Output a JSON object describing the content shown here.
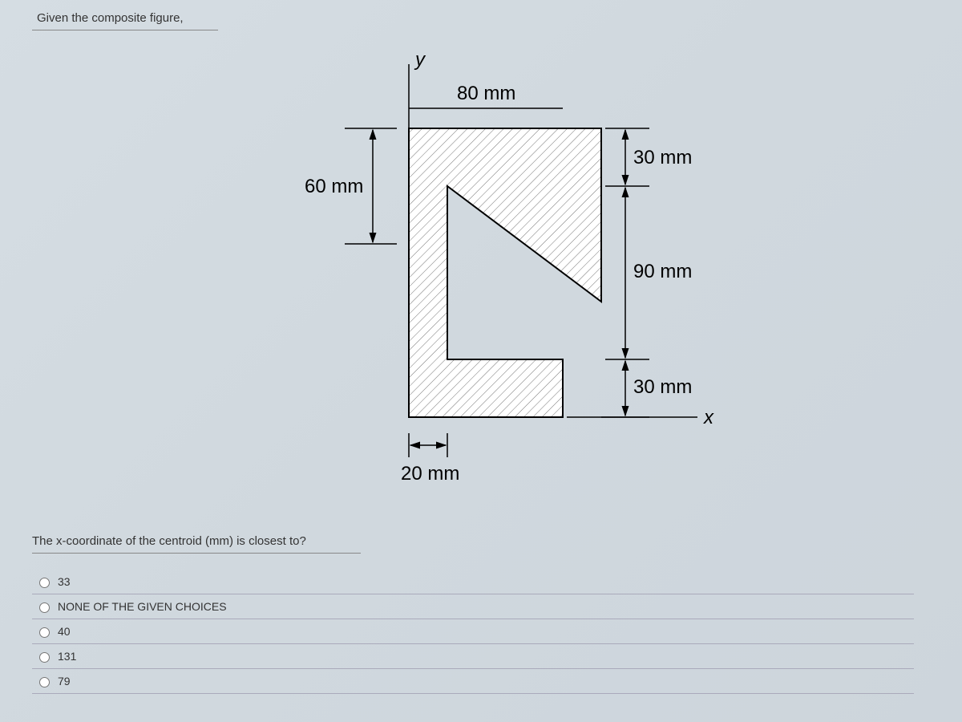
{
  "prompt": "Given the composite figure,",
  "question": "The x-coordinate of the centroid (mm) is closest to?",
  "axes": {
    "x": "x",
    "y": "y"
  },
  "dimensions": {
    "top_width": "80 mm",
    "left_height": "60 mm",
    "bottom_width": "20 mm",
    "right_top": "30 mm",
    "right_mid": "90 mm",
    "right_bot": "30 mm"
  },
  "choices": [
    {
      "label": "33"
    },
    {
      "label": "NONE OF THE GIVEN CHOICES"
    },
    {
      "label": "40"
    },
    {
      "label": "131"
    },
    {
      "label": "79"
    }
  ]
}
